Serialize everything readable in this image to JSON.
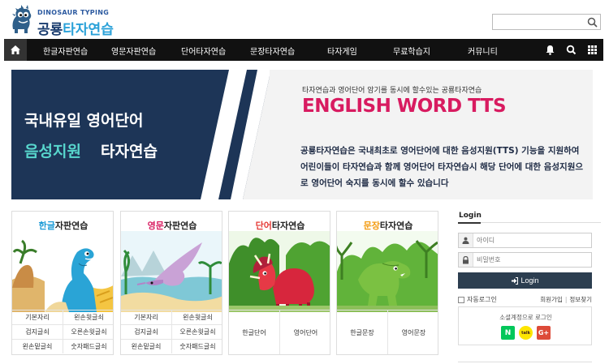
{
  "header": {
    "logo_sub": "DINOSAUR TYPING",
    "logo_main_a": "공룡",
    "logo_main_b": "타자연습",
    "search": {
      "placeholder": ""
    }
  },
  "nav": {
    "items": [
      "한글자판연습",
      "영문자판연습",
      "단어타자연습",
      "문장타자연습",
      "타자게임",
      "무료학습지",
      "커뮤니티"
    ],
    "icons": [
      "home-icon",
      "bell-icon",
      "search-icon",
      "grid-icon"
    ]
  },
  "banner": {
    "left_line1": "국내유일 영어단어",
    "left_line2_accent": "음성지원",
    "left_line2_rest": "타자연습",
    "right_sub": "타자연습과 영어단어 암기를 동시에 할수있는 공룡타자연습",
    "right_title": "ENGLISH WORD TTS",
    "right_desc": "공룡타자연습은 국내최초로 영어단어에 대한 음성지원(TTS) 기능을 지원하여 어린이들이 타자연습과 함께 영어단어 타자연습시 해당 단어에 대한 음성지원으로 영어단어 숙지를 동시에 할수 있습니다",
    "colors": {
      "navy": "#1d3557",
      "teal": "#58d6cd",
      "pink": "#d81b60"
    }
  },
  "cards": [
    {
      "title_hl": "한글",
      "title_rest": "자판연습",
      "hl_color": "#1a9ad6",
      "cells": [
        "기본자리",
        "왼손윗글쇠",
        "검지글쇠",
        "오른손윗글쇠",
        "왼손밑글쇠",
        "숫자패드글쇠"
      ]
    },
    {
      "title_hl": "영문",
      "title_rest": "자판연습",
      "hl_color": "#d81b60",
      "cells": [
        "기본자리",
        "왼손윗글쇠",
        "검지글쇠",
        "오른손윗글쇠",
        "왼손밑글쇠",
        "숫자패드글쇠"
      ]
    },
    {
      "title_hl": "단어",
      "title_rest": "타자연습",
      "hl_color": "#e53935",
      "cells": [
        "한글단어",
        "영어단어"
      ]
    },
    {
      "title_hl": "문장",
      "title_rest": "타자연습",
      "hl_color": "#f39c12",
      "cells": [
        "한글문장",
        "영어문장"
      ]
    }
  ],
  "login": {
    "title": "Login",
    "id_placeholder": "아이디",
    "pw_placeholder": "비밀번호",
    "button": "Login",
    "auto_login": "자동로그인",
    "join": "회원가입",
    "find": "정보찾기",
    "social_label": "소셜계정으로 로그인",
    "social": [
      {
        "name": "naver",
        "text": "N",
        "color": "#03c75a"
      },
      {
        "name": "kakao",
        "text": "talk",
        "color": "#fee500"
      },
      {
        "name": "google",
        "text": "G+",
        "color": "#dd4b39"
      }
    ]
  }
}
